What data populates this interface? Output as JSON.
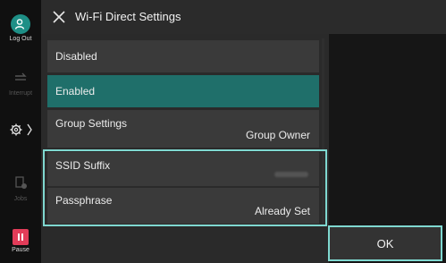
{
  "header": {
    "title": "Wi-Fi Direct Settings"
  },
  "rail": {
    "logout_label": "Log Out",
    "interrupt_label": "Interrupt",
    "jobs_label": "Jobs",
    "pause_label": "Pause"
  },
  "options": {
    "disabled": "Disabled",
    "enabled": "Enabled",
    "selected": "Enabled"
  },
  "settings": {
    "group_settings_label": "Group Settings",
    "group_settings_value": "Group Owner",
    "ssid_suffix_label": "SSID Suffix",
    "passphrase_label": "Passphrase",
    "passphrase_value": "Already Set"
  },
  "actions": {
    "ok_label": "OK"
  },
  "colors": {
    "accent": "#1f6f6a",
    "focus": "#7fd8d0",
    "logout": "#1e8f86",
    "pause": "#e23c59"
  }
}
